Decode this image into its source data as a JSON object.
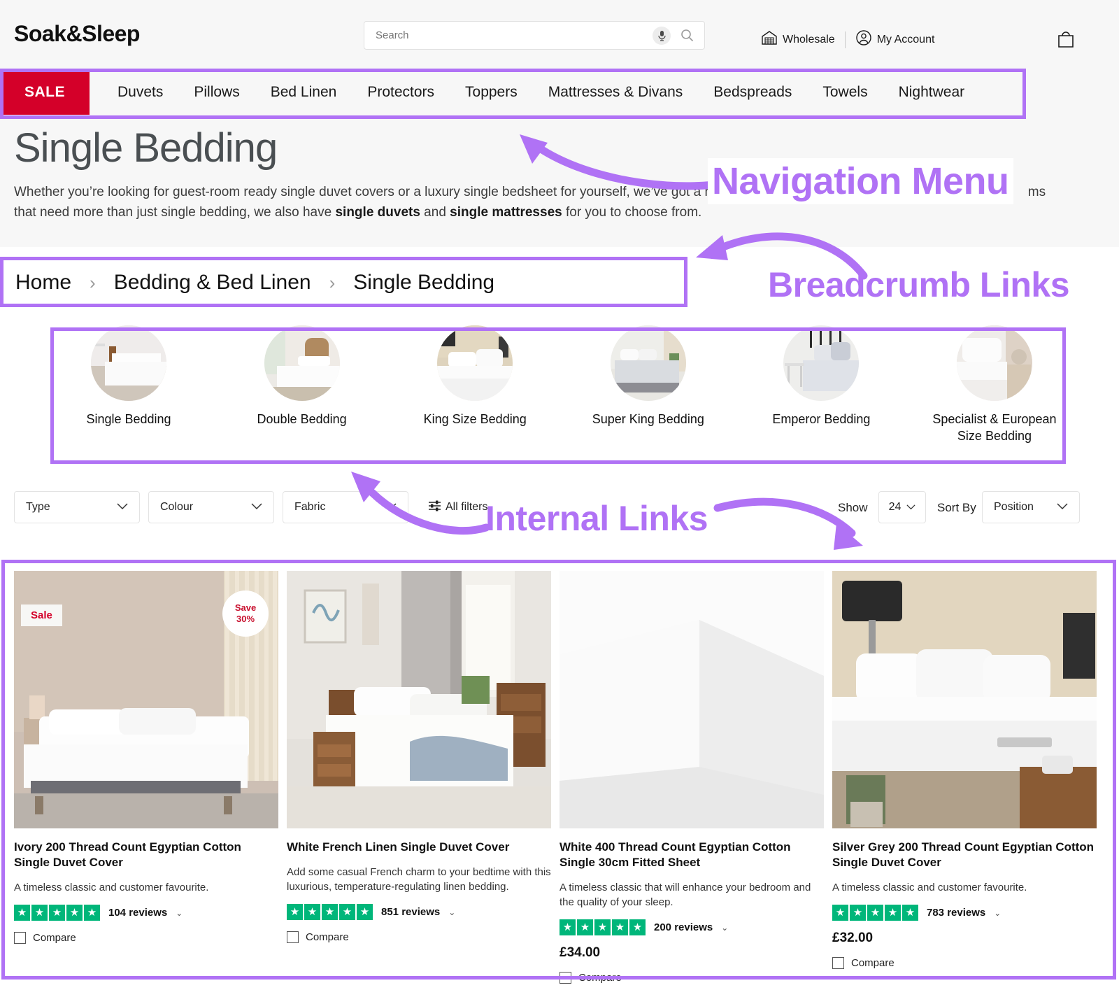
{
  "header": {
    "logo": "Soak&Sleep",
    "search_placeholder": "Search",
    "search_value": "",
    "mic_icon": "microphone-icon",
    "search_icon": "search-icon",
    "wholesale_label": "Wholesale",
    "account_label": "My Account",
    "bag_icon": "shopping-bag-icon"
  },
  "nav": {
    "sale_label": "SALE",
    "items": [
      {
        "label": "Duvets"
      },
      {
        "label": "Pillows"
      },
      {
        "label": "Bed Linen"
      },
      {
        "label": "Protectors"
      },
      {
        "label": "Toppers"
      },
      {
        "label": "Mattresses & Divans"
      },
      {
        "label": "Bedspreads"
      },
      {
        "label": "Towels"
      },
      {
        "label": "Nightwear"
      }
    ]
  },
  "hero": {
    "title": "Single Bedding",
    "desc_part1": "Whether you’re looking for guest-room ready single duvet covers or a luxury single bedsheet for yourself, we’ve got a host of ",
    "desc_part2": "",
    "desc_part3": "ms that need more than just single bedding, we also have ",
    "desc_link1": "single duvets",
    "desc_and": " and ",
    "desc_link2": "single mattresses",
    "desc_part4": " for you to choose from."
  },
  "breadcrumb": {
    "sep": "›",
    "items": [
      {
        "label": "Home"
      },
      {
        "label": "Bedding & Bed Linen"
      },
      {
        "label": "Single Bedding"
      }
    ]
  },
  "categories": {
    "prev_icon": "arrow-left-circle-icon",
    "next_icon": "arrow-right-circle-icon",
    "items": [
      {
        "label": "Single Bedding"
      },
      {
        "label": "Double Bedding"
      },
      {
        "label": "King Size Bedding"
      },
      {
        "label": "Super King Bedding"
      },
      {
        "label": "Emperor Bedding"
      },
      {
        "label": "Specialist & European Size Bedding"
      }
    ]
  },
  "filters": {
    "type_label": "Type",
    "colour_label": "Colour",
    "fabric_label": "Fabric",
    "all_filters_label": "All filters",
    "all_filters_icon": "sliders-icon",
    "show_label": "Show",
    "show_value": "24",
    "sort_label": "Sort By",
    "sort_value": "Position",
    "chevron_icon": "chevron-down-icon"
  },
  "products": [
    {
      "title": "Ivory 200 Thread Count Egyptian Cotton Single Duvet Cover",
      "desc": "A timeless classic and customer favourite.",
      "rating": 5,
      "reviews": "104 reviews",
      "price": "",
      "compare_label": "Compare",
      "sale_badge": "Sale",
      "save_badge_line1": "Save",
      "save_badge_line2": "30%"
    },
    {
      "title": "White French Linen Single Duvet Cover",
      "desc": "Add some casual French charm to your bedtime with this luxurious, temperature-regulating linen bedding.",
      "rating": 5,
      "reviews": "851 reviews",
      "price": "",
      "compare_label": "Compare",
      "sale_badge": "",
      "save_badge_line1": "",
      "save_badge_line2": ""
    },
    {
      "title": "White 400 Thread Count Egyptian Cotton Single 30cm Fitted Sheet",
      "desc": "A timeless classic that will enhance your bedroom and the quality of your sleep.",
      "rating": 5,
      "reviews": "200 reviews",
      "price": "£34.00",
      "compare_label": "Compare",
      "sale_badge": "",
      "save_badge_line1": "",
      "save_badge_line2": ""
    },
    {
      "title": "Silver Grey 200 Thread Count Egyptian Cotton Single Duvet Cover",
      "desc": "A timeless classic and customer favourite.",
      "rating": 5,
      "reviews": "783 reviews",
      "price": "£32.00",
      "compare_label": "Compare",
      "sale_badge": "",
      "save_badge_line1": "",
      "save_badge_line2": ""
    }
  ],
  "annotations": {
    "accent_color": "#b072f5",
    "labels": [
      {
        "text": "Navigation Menu"
      },
      {
        "text": "Breadcrumb Links"
      },
      {
        "text": "Internal Links"
      }
    ]
  },
  "colors": {
    "sale_red": "#d40029",
    "star_green": "#00b67a",
    "annotation_purple": "#b072f5",
    "header_bg": "#f7f7f7"
  }
}
